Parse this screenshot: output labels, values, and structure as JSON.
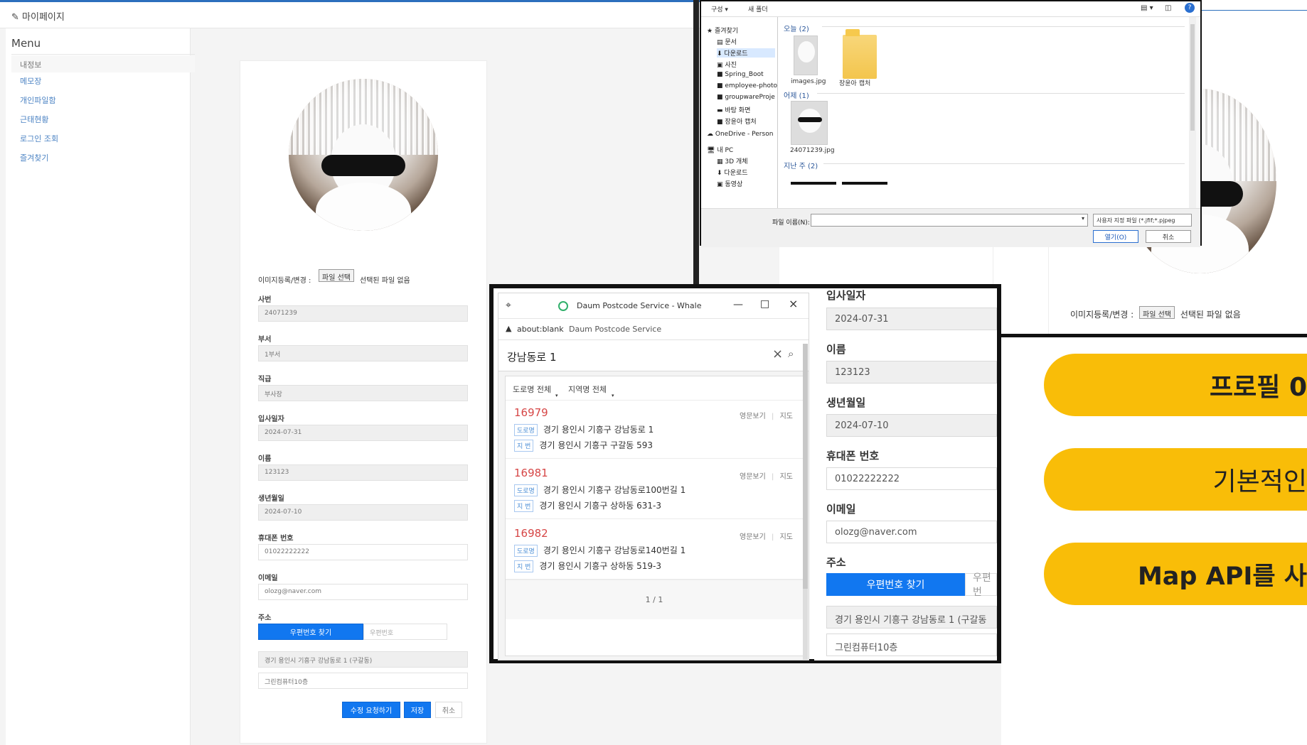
{
  "topbar": {
    "title": "마이페이지"
  },
  "sidebar": {
    "menu_title": "Menu",
    "items": [
      "내정보",
      "메모장",
      "개인파일함",
      "근태현황",
      "로그인 조회",
      "즐겨찾기"
    ]
  },
  "profile_small": {
    "image_label": "이미지등록/변경 :",
    "file_button": "파일 선택",
    "file_status": "선택된 파일 없음",
    "fields": [
      {
        "label": "사번",
        "value": "24071239"
      },
      {
        "label": "부서",
        "value": "1부서"
      },
      {
        "label": "직급",
        "value": "부사장"
      },
      {
        "label": "입사일자",
        "value": "2024-07-31"
      },
      {
        "label": "이름",
        "value": "123123"
      },
      {
        "label": "생년월일",
        "value": "2024-07-10"
      },
      {
        "label": "휴대폰 번호",
        "value": "01022222222"
      },
      {
        "label": "이메일",
        "value": "olozg@naver.com"
      }
    ],
    "address_label": "주소",
    "postcode_button": "우편번호 찾기",
    "postcode_placeholder": "우편번호",
    "address_value": "경기 용인시 기흥구 강남동로 1 (구갈동)",
    "detail_value": "그린컴퓨터10층",
    "actions": [
      "수정 요청하기",
      "저장",
      "취소"
    ]
  },
  "file_dialog": {
    "toolbar": {
      "organize": "구성 ▾",
      "new_folder": "새 폴더"
    },
    "tree": [
      "즐겨찾기",
      "문서",
      "다운로드",
      "사진",
      "Spring_Boot",
      "employee-photo",
      "groupwareProje",
      "바탕 화면",
      "장윤아 캡처",
      "OneDrive - Person",
      "내 PC",
      "3D 개체",
      "다운로드",
      "동영상"
    ],
    "groups": {
      "today": "오늘 (2)",
      "yesterday": "어제 (1)",
      "last_week": "지난 주 (2)"
    },
    "files": {
      "image1": "images.jpg",
      "folder1": "장윤아 캡처",
      "image2": "24071239.jpg"
    },
    "filename_label": "파일 이름(N):",
    "filetype": "사용자 지정 파일 (*.jfif;*.pjpeg",
    "open_button": "열기(O)",
    "cancel_button": "취소"
  },
  "popup": {
    "title": "Daum Postcode Service - Whale",
    "url": "about:blank",
    "url_title": "Daum Postcode Service",
    "search_value": "강남동로 1",
    "filters": [
      "도로명 전체",
      "지역명 전체"
    ],
    "results": [
      {
        "code": "16979",
        "road": "경기 용인시 기흥구 강남동로 1",
        "jibun": "경기 용인시 기흥구 구갈동 593"
      },
      {
        "code": "16981",
        "road": "경기 용인시 기흥구 강남동로100번길 1",
        "jibun": "경기 용인시 기흥구 상하동 631-3"
      },
      {
        "code": "16982",
        "road": "경기 용인시 기흥구 강남동로140번길 1",
        "jibun": "경기 용인시 기흥구 상하동 519-3"
      }
    ],
    "tag_road": "도로명",
    "tag_jibun": "지 번",
    "english": "영문보기",
    "map": "지도",
    "page": "1 / 1"
  },
  "profile_large": {
    "fields": [
      {
        "label": "입사일자",
        "value": "2024-07-31"
      },
      {
        "label": "이름",
        "value": "123123"
      },
      {
        "label": "생년월일",
        "value": "2024-07-10"
      },
      {
        "label": "휴대폰 번호",
        "value": "01022222222"
      },
      {
        "label": "이메일",
        "value": "olozg@naver.com"
      }
    ],
    "address_label": "주소",
    "postcode_button": "우편번호 찾기",
    "postcode_partial": "우편번",
    "address_value": "경기 용인시 기흥구 강남동로 1 (구갈동",
    "detail_value": "그린컴퓨터10층"
  },
  "right_profile": {
    "image_label": "이미지등록/변경 :",
    "file_button": "파일 선택",
    "file_status": "선택된 파일 없음"
  },
  "banners": [
    {
      "text": "프로필 0",
      "bold": true
    },
    {
      "text": "기본적인",
      "bold": false
    },
    {
      "text": "Map API를 사",
      "bold": true
    }
  ],
  "colors": {
    "accent_blue": "#1177f0",
    "banner_yellow": "#f9bd08",
    "postcode_red": "#d64646"
  }
}
